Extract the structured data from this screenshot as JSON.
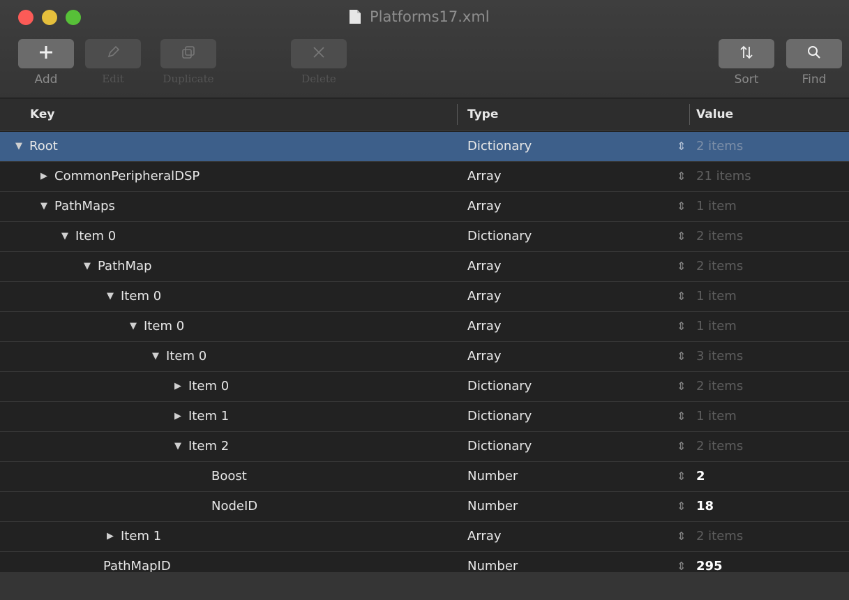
{
  "window": {
    "title": "Platforms17.xml"
  },
  "toolbar": {
    "add": "Add",
    "edit": "Edit",
    "duplicate": "Duplicate",
    "delete": "Delete",
    "sort": "Sort",
    "find": "Find"
  },
  "columns": {
    "key": "Key",
    "type": "Type",
    "value": "Value"
  },
  "rows": [
    {
      "key": "Root",
      "type": "Dictionary",
      "value": "2 items"
    },
    {
      "key": "CommonPeripheralDSP",
      "type": "Array",
      "value": "21 items"
    },
    {
      "key": "PathMaps",
      "type": "Array",
      "value": "1 item"
    },
    {
      "key": "Item 0",
      "type": "Dictionary",
      "value": "2 items"
    },
    {
      "key": "PathMap",
      "type": "Array",
      "value": "2 items"
    },
    {
      "key": "Item 0",
      "type": "Array",
      "value": "1 item"
    },
    {
      "key": "Item 0",
      "type": "Array",
      "value": "1 item"
    },
    {
      "key": "Item 0",
      "type": "Array",
      "value": "3 items"
    },
    {
      "key": "Item 0",
      "type": "Dictionary",
      "value": "2 items"
    },
    {
      "key": "Item 1",
      "type": "Dictionary",
      "value": "1 item"
    },
    {
      "key": "Item 2",
      "type": "Dictionary",
      "value": "2 items"
    },
    {
      "key": "Boost",
      "type": "Number",
      "value": "2"
    },
    {
      "key": "NodeID",
      "type": "Number",
      "value": "18"
    },
    {
      "key": "Item 1",
      "type": "Array",
      "value": "2 items"
    },
    {
      "key": "PathMapID",
      "type": "Number",
      "value": "295"
    }
  ]
}
